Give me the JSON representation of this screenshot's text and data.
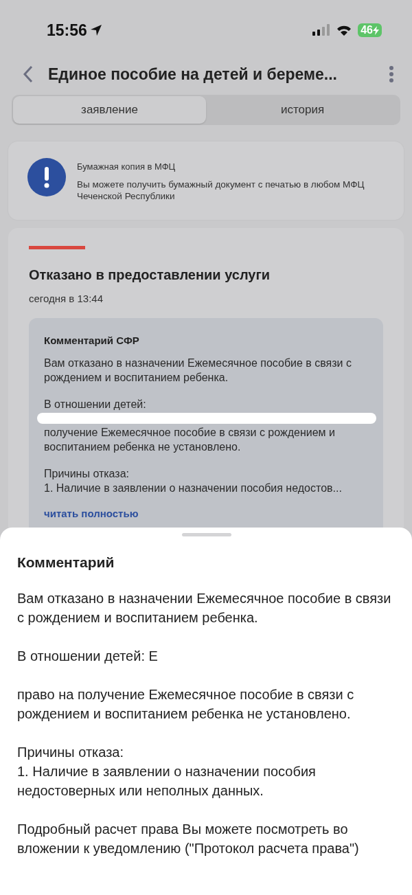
{
  "status_bar": {
    "time": "15:56",
    "battery": "46"
  },
  "header": {
    "title": "Единое пособие на детей и береме..."
  },
  "tabs": [
    {
      "label": "заявление",
      "selected": true
    },
    {
      "label": "история",
      "selected": false
    }
  ],
  "info_card": {
    "title": "Бумажная копия в МФЦ",
    "text": "Вы можете получить бумажный документ с печатью в любом МФЦ Чеченской Республики"
  },
  "status_card": {
    "status": "Отказано в предоставлении услуги",
    "color": "#d9473f",
    "time": "сегодня в 13:44",
    "comment": {
      "title": "Комментарий СФР",
      "paragraphs": [
        {
          "kind": "text",
          "text": "Вам отказано в назначении Ежемесячное пособие в связи с рождением и воспитанием ребенка."
        },
        {
          "kind": "redacted",
          "before": "В отношении детей:",
          "after": "получение Ежемесячное пособие в связи с рождением и воспитанием ребенка не установлено."
        },
        {
          "kind": "text",
          "text": "Причины отказа:\n1. Наличие в заявлении о назначении пособия недостов..."
        }
      ],
      "link": "читать полностью"
    }
  },
  "sheet": {
    "title": "Комментарий",
    "paragraphs": [
      {
        "kind": "text",
        "text": "Вам отказано в назначении Ежемесячное пособие в связи с рождением и воспитанием ребенка."
      },
      {
        "kind": "redacted",
        "before": "В отношении детей: Е",
        "after": "право на получение Ежемесячное пособие в связи с рождением и воспитанием ребенка не установлено."
      },
      {
        "kind": "text",
        "text": "Причины отказа:\n1. Наличие в заявлении о назначении пособия недостоверных или неполных данных."
      },
      {
        "kind": "text",
        "text": "Подробный расчет права Вы можете посмотреть во вложении к уведомлению (\"Протокол расчета права\")"
      }
    ]
  }
}
